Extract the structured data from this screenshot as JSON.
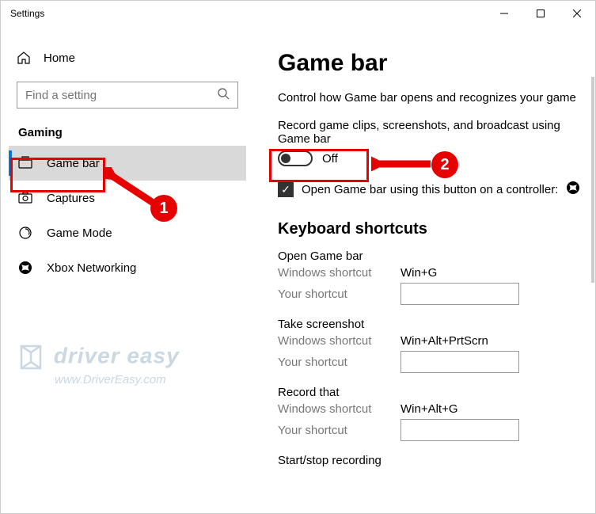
{
  "window": {
    "title": "Settings"
  },
  "sidebar": {
    "home": "Home",
    "search_placeholder": "Find a setting",
    "section": "Gaming",
    "items": [
      {
        "label": "Game bar"
      },
      {
        "label": "Captures"
      },
      {
        "label": "Game Mode"
      },
      {
        "label": "Xbox Networking"
      }
    ]
  },
  "content": {
    "title": "Game bar",
    "desc": "Control how Game bar opens and recognizes your game",
    "record_desc": "Record game clips, screenshots, and broadcast using Game bar",
    "toggle_state": "Off",
    "checkbox_label": "Open Game bar using this button on a controller:",
    "shortcuts_header": "Keyboard shortcuts",
    "shortcuts": [
      {
        "title": "Open Game bar",
        "win_label": "Windows shortcut",
        "win_val": "Win+G",
        "your_label": "Your shortcut",
        "your_val": ""
      },
      {
        "title": "Take screenshot",
        "win_label": "Windows shortcut",
        "win_val": "Win+Alt+PrtScrn",
        "your_label": "Your shortcut",
        "your_val": ""
      },
      {
        "title": "Record that",
        "win_label": "Windows shortcut",
        "win_val": "Win+Alt+G",
        "your_label": "Your shortcut",
        "your_val": ""
      }
    ],
    "last_title": "Start/stop recording"
  },
  "annotations": {
    "badge1": "1",
    "badge2": "2"
  },
  "watermark": {
    "line1": "driver easy",
    "line2": "www.DriverEasy.com"
  }
}
